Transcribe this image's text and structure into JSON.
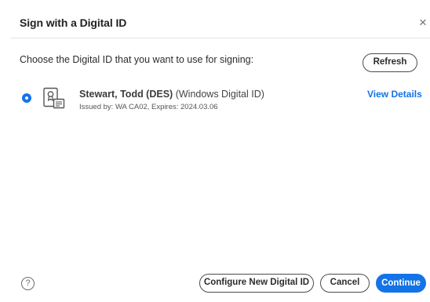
{
  "dialog": {
    "title": "Sign with a Digital ID",
    "close_glyph": "×"
  },
  "prompt": "Choose the Digital ID that you want to use for signing:",
  "refresh_label": "Refresh",
  "digital_ids": [
    {
      "name": "Stewart, Todd (DES)",
      "type": "(Windows Digital ID)",
      "issued": "Issued by: WA CA02, Expires: 2024.03.06",
      "selected": true,
      "view_details_label": "View Details"
    }
  ],
  "footer": {
    "help_glyph": "?",
    "configure_label": "Configure New Digital ID",
    "cancel_label": "Cancel",
    "continue_label": "Continue"
  },
  "colors": {
    "accent": "#1473e6",
    "text": "#2c2c2c",
    "divider": "#e4e4e4"
  },
  "icons": {
    "close": "close-icon",
    "radio": "radio-selected-icon",
    "certificate": "certificate-icon",
    "help": "help-icon"
  }
}
